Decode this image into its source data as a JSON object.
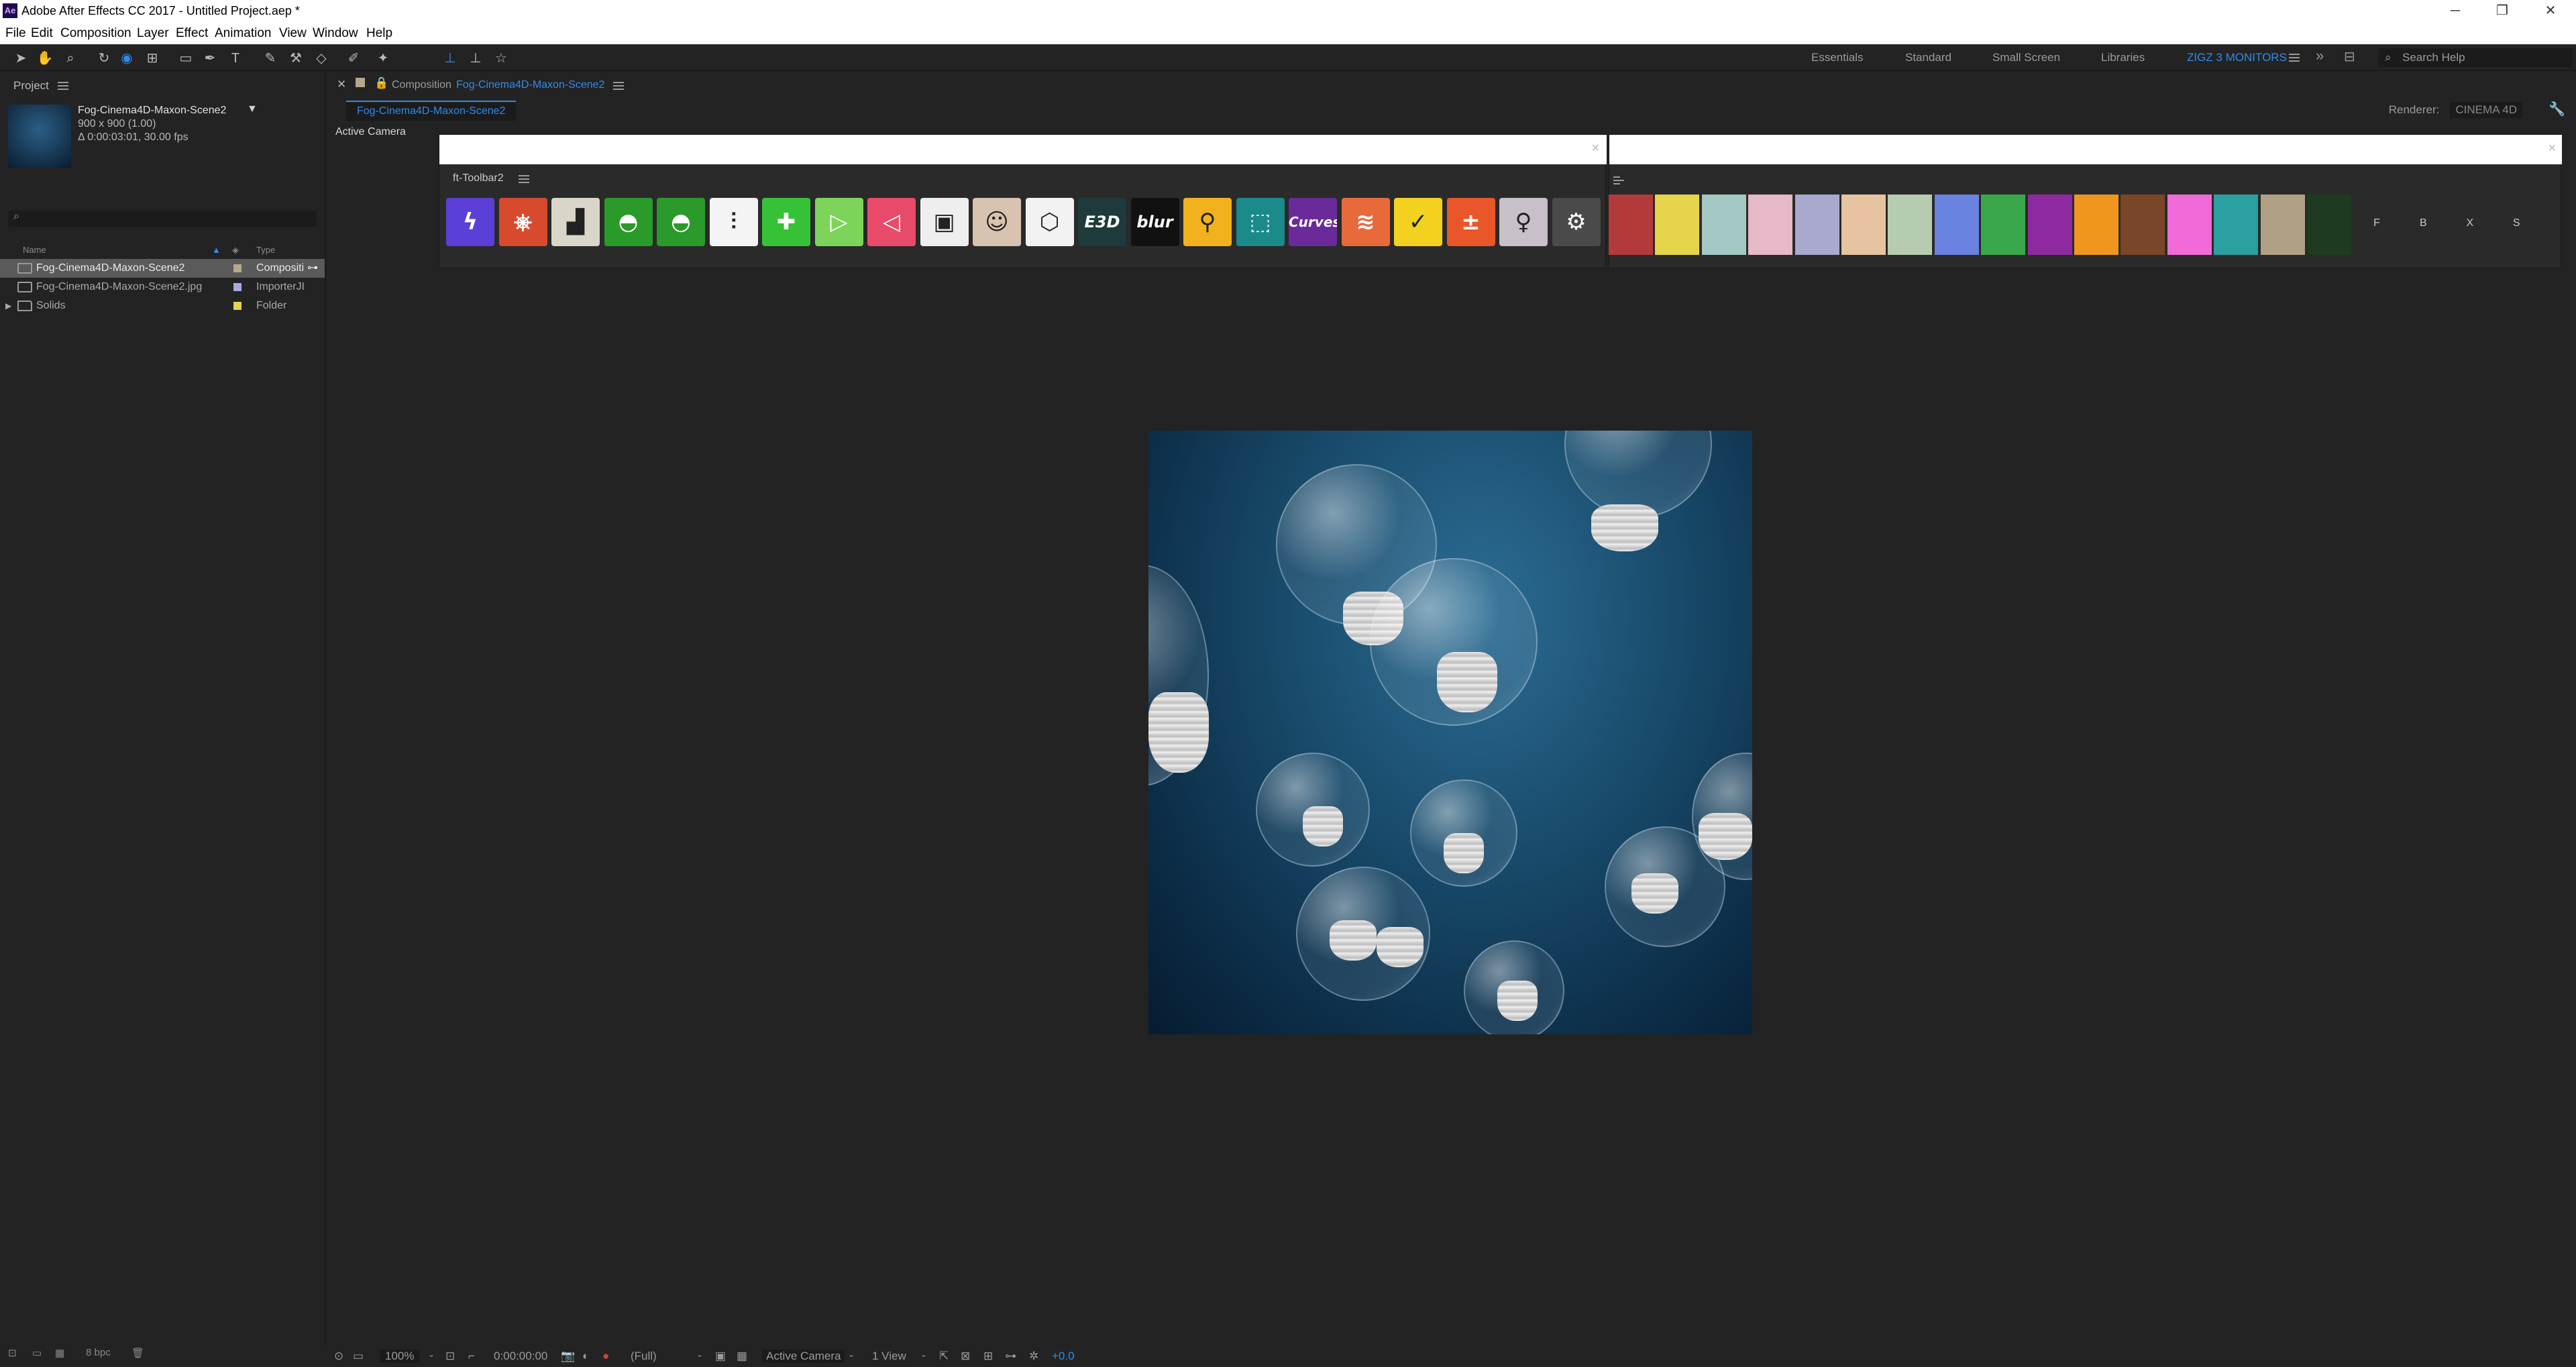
{
  "window": {
    "title": "Adobe After Effects CC 2017 - Untitled Project.aep *",
    "app_icon": "Ae",
    "controls": {
      "minimize": "─",
      "restore": "❐",
      "close": "✕"
    }
  },
  "menu": [
    "File",
    "Edit",
    "Composition",
    "Layer",
    "Effect",
    "Animation",
    "View",
    "Window",
    "Help"
  ],
  "workspaces": {
    "items": [
      "Essentials",
      "Standard",
      "Small Screen",
      "Libraries",
      "ZIGZ 3 MONITORS"
    ],
    "active": "ZIGZ 3 MONITORS",
    "overflow": "»",
    "search_placeholder": "Search Help"
  },
  "project_panel": {
    "tab": "Project",
    "selected_item": {
      "name": "Fog-Cinema4D-Maxon-Scene2",
      "size": "900 x 900 (1.00)",
      "duration": "Δ 0:00:03:01, 30.00 fps"
    },
    "search_icon": "⌕",
    "columns": {
      "name": "Name",
      "type": "Type"
    },
    "items": [
      {
        "name": "Fog-Cinema4D-Maxon-Scene2",
        "type": "Compositi",
        "label_color": "#b5a88c",
        "selected": true
      },
      {
        "name": "Fog-Cinema4D-Maxon-Scene2.jpg",
        "type": "ImporterJI",
        "label_color": "#a9a9e0",
        "selected": false
      },
      {
        "name": "Solids",
        "type": "Folder",
        "label_color": "#e6d44a",
        "selected": false
      }
    ],
    "footer": {
      "bpc": "8 bpc"
    }
  },
  "composition_panel": {
    "tab_prefix": "Composition",
    "tab_name": "Fog-Cinema4D-Maxon-Scene2",
    "sub_tab": "Fog-Cinema4D-Maxon-Scene2",
    "renderer_label": "Renderer:",
    "renderer_value": "CINEMA 4D",
    "view_label": "Active Camera"
  },
  "ft_toolbar": {
    "title": "ft-Toolbar2",
    "icons": [
      {
        "name": "lightning-icon",
        "glyph": "ϟ",
        "bg": "#5b3fd6"
      },
      {
        "name": "camera-rig-icon",
        "glyph": "⎈",
        "bg": "#d84a2e"
      },
      {
        "name": "stairs-icon",
        "glyph": "▟",
        "bg": "#d9d5c8"
      },
      {
        "name": "sunset-icon-1",
        "glyph": "◓",
        "bg": "#2a9a2a"
      },
      {
        "name": "sunset-icon-2",
        "glyph": "◓",
        "bg": "#2a9a2a"
      },
      {
        "name": "sliders-icon",
        "glyph": "⫶",
        "bg": "#f4f4f4"
      },
      {
        "name": "plus-cross-icon",
        "glyph": "✚",
        "bg": "#36c236"
      },
      {
        "name": "plus-play-icon",
        "glyph": "▷",
        "bg": "#7dd45a"
      },
      {
        "name": "rewind-icon",
        "glyph": "◁",
        "bg": "#e84a6a"
      },
      {
        "name": "image-frame-icon",
        "glyph": "▣",
        "bg": "#eeeeee"
      },
      {
        "name": "portrait-icon",
        "glyph": "☺",
        "bg": "#d8c2b0"
      },
      {
        "name": "cube-icon",
        "glyph": "⬡",
        "bg": "#f2f2f2"
      },
      {
        "name": "e3d-icon",
        "glyph": "E3D",
        "bg": "#1e3a3a"
      },
      {
        "name": "blur-icon",
        "glyph": "blur",
        "bg": "#111111"
      },
      {
        "name": "joystick-icon",
        "glyph": "⚲",
        "bg": "#f2b21e"
      },
      {
        "name": "crop-frame-icon",
        "glyph": "⬚",
        "bg": "#1a8a8a"
      },
      {
        "name": "curves-icon",
        "glyph": "Curves",
        "bg": "#6a2a9a"
      },
      {
        "name": "motion-icon",
        "glyph": "≋",
        "bg": "#e86a3a"
      },
      {
        "name": "clapper-check-icon",
        "glyph": "✓",
        "bg": "#f2d21e"
      },
      {
        "name": "calculator-icon",
        "glyph": "±",
        "bg": "#e8562a"
      },
      {
        "name": "figure-icon",
        "glyph": "♀",
        "bg": "#c8c0c8"
      },
      {
        "name": "settings-gear-icon",
        "glyph": "⚙",
        "bg": "#4a4a4a"
      }
    ]
  },
  "label_colors": {
    "swatches": [
      "#b23a3a",
      "#e6d44a",
      "#a4c8c4",
      "#e6b8c8",
      "#a9a9d0",
      "#e6c4a0",
      "#b6ccb0",
      "#6a82e0",
      "#3aa84a",
      "#8e2aa0",
      "#f0961e",
      "#7a4628",
      "#f06ad8",
      "#2aa0a0",
      "#b0a084",
      "#1e3a20"
    ],
    "buttons": [
      "F",
      "B",
      "X",
      "S"
    ]
  },
  "statusbar": {
    "zoom": "100%",
    "timecode": "0:00:00:00",
    "resolution": "(Full)",
    "camera": "Active Camera",
    "views": "1 View",
    "exposure": "+0.0"
  }
}
